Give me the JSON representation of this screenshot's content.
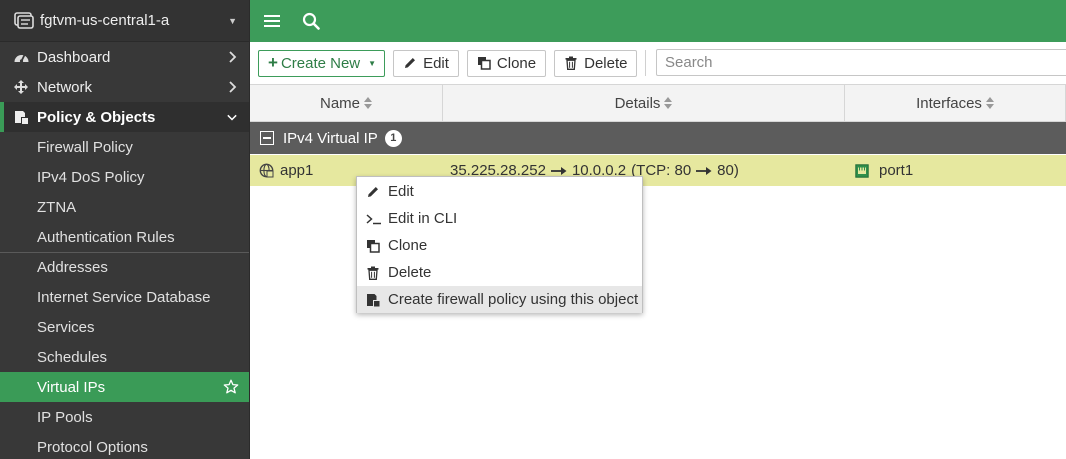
{
  "sidebar": {
    "device_name": "fgtvm-us-central1-a",
    "nav": [
      {
        "label": "Dashboard",
        "icon": "dashboard-icon"
      },
      {
        "label": "Network",
        "icon": "network-icon"
      },
      {
        "label": "Policy & Objects",
        "icon": "policy-icon"
      }
    ],
    "sub_items": [
      {
        "label": "Firewall Policy"
      },
      {
        "label": "IPv4 DoS Policy"
      },
      {
        "label": "ZTNA"
      },
      {
        "label": "Authentication Rules"
      },
      {
        "label": "Addresses"
      },
      {
        "label": "Internet Service Database"
      },
      {
        "label": "Services"
      },
      {
        "label": "Schedules"
      },
      {
        "label": "Virtual IPs"
      },
      {
        "label": "IP Pools"
      },
      {
        "label": "Protocol Options"
      }
    ],
    "selected": "Virtual IPs"
  },
  "toolbar": {
    "create_label": "Create New",
    "edit_label": "Edit",
    "clone_label": "Clone",
    "delete_label": "Delete",
    "search_placeholder": "Search"
  },
  "table": {
    "columns": [
      "Name",
      "Details",
      "Interfaces"
    ],
    "group": {
      "label": "IPv4 Virtual IP",
      "count": "1"
    },
    "rows": [
      {
        "name": "app1",
        "ext_ip": "35.225.28.252",
        "map_ip": "10.0.0.2",
        "port_prefix": "(TCP: 80",
        "port_suffix": "80)",
        "interface": "port1"
      }
    ]
  },
  "context_menu": [
    {
      "label": "Edit",
      "icon": "pencil-icon"
    },
    {
      "label": "Edit in CLI",
      "icon": "cli-icon"
    },
    {
      "label": "Clone",
      "icon": "clone-icon"
    },
    {
      "label": "Delete",
      "icon": "trash-icon"
    },
    {
      "label": "Create firewall policy using this object",
      "icon": "policy-icon"
    }
  ],
  "colors": {
    "brand_green": "#3d9c5a",
    "sidebar_bg": "#383838",
    "group_bg": "#5c5c5c",
    "row_highlight": "#e6e89f"
  }
}
